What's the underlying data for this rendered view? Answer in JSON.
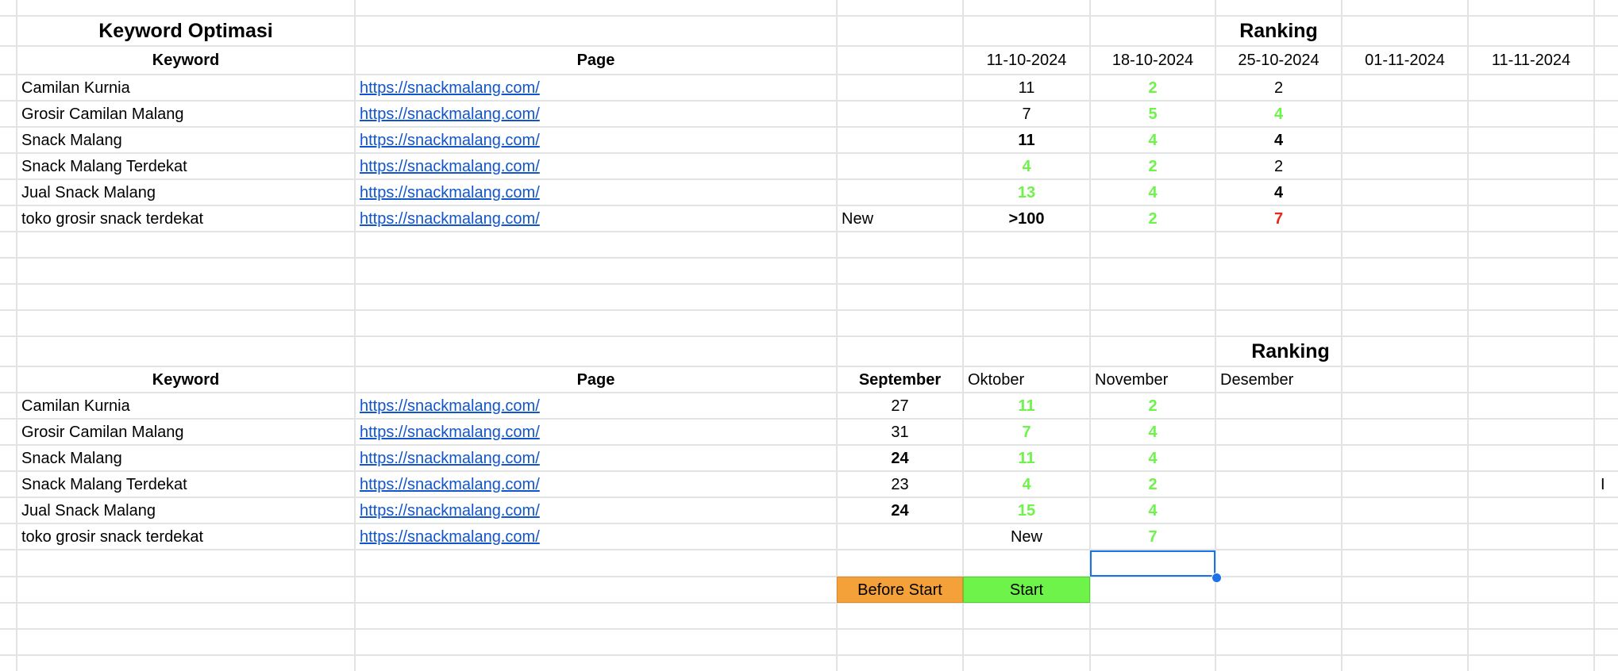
{
  "colors": {
    "link": "#1155cc",
    "ranking_improved": "#6ef34a",
    "ranking_dropped": "#e8271d",
    "before_start_fill": "#f4a13a",
    "start_fill": "#6ef34a",
    "gridline": "#e2e3e3",
    "selection": "#1a73e8"
  },
  "weekly": {
    "title": "Keyword Optimasi",
    "ranking_title": "Ranking",
    "headers": {
      "keyword": "Keyword",
      "page": "Page"
    },
    "dates": [
      "11-10-2024",
      "18-10-2024",
      "25-10-2024",
      "01-11-2024",
      "11-11-2024"
    ],
    "rows": [
      {
        "keyword": "Camilan Kurnia",
        "page": "https://snackmalang.com/",
        "note": "",
        "ranks": [
          {
            "v": "11",
            "s": "normal"
          },
          {
            "v": "2",
            "s": "green"
          },
          {
            "v": "2",
            "s": "normal"
          }
        ]
      },
      {
        "keyword": "Grosir Camilan Malang",
        "page": "https://snackmalang.com/",
        "note": "",
        "ranks": [
          {
            "v": "7",
            "s": "normal"
          },
          {
            "v": "5",
            "s": "green"
          },
          {
            "v": "4",
            "s": "green"
          }
        ]
      },
      {
        "keyword": "Snack Malang",
        "page": "https://snackmalang.com/",
        "note": "",
        "ranks": [
          {
            "v": "11",
            "s": "bold"
          },
          {
            "v": "4",
            "s": "green"
          },
          {
            "v": "4",
            "s": "bold"
          }
        ]
      },
      {
        "keyword": "Snack Malang Terdekat",
        "page": "https://snackmalang.com/",
        "note": "",
        "ranks": [
          {
            "v": "4",
            "s": "green"
          },
          {
            "v": "2",
            "s": "green"
          },
          {
            "v": "2",
            "s": "normal"
          }
        ]
      },
      {
        "keyword": "Jual Snack Malang",
        "page": "https://snackmalang.com/",
        "note": "",
        "ranks": [
          {
            "v": "13",
            "s": "green"
          },
          {
            "v": "4",
            "s": "green"
          },
          {
            "v": "4",
            "s": "bold"
          }
        ]
      },
      {
        "keyword": "toko grosir snack terdekat",
        "page": "https://snackmalang.com/",
        "note": "New",
        "ranks": [
          {
            "v": ">100",
            "s": "bold"
          },
          {
            "v": "2",
            "s": "green"
          },
          {
            "v": "7",
            "s": "red"
          }
        ]
      }
    ]
  },
  "monthly": {
    "ranking_title": "Ranking",
    "headers": {
      "keyword": "Keyword",
      "page": "Page"
    },
    "months": [
      "September",
      "Oktober",
      "November",
      "Desember"
    ],
    "rows": [
      {
        "keyword": "Camilan Kurnia",
        "page": "https://snackmalang.com/",
        "ranks": [
          {
            "v": "27",
            "s": "normal"
          },
          {
            "v": "11",
            "s": "green"
          },
          {
            "v": "2",
            "s": "green"
          }
        ]
      },
      {
        "keyword": "Grosir Camilan Malang",
        "page": "https://snackmalang.com/",
        "ranks": [
          {
            "v": "31",
            "s": "normal"
          },
          {
            "v": "7",
            "s": "green"
          },
          {
            "v": "4",
            "s": "green"
          }
        ]
      },
      {
        "keyword": "Snack Malang",
        "page": "https://snackmalang.com/",
        "ranks": [
          {
            "v": "24",
            "s": "bold"
          },
          {
            "v": "11",
            "s": "green"
          },
          {
            "v": "4",
            "s": "green"
          }
        ]
      },
      {
        "keyword": "Snack Malang Terdekat",
        "page": "https://snackmalang.com/",
        "ranks": [
          {
            "v": "23",
            "s": "normal"
          },
          {
            "v": "4",
            "s": "green"
          },
          {
            "v": "2",
            "s": "green"
          }
        ]
      },
      {
        "keyword": "Jual Snack Malang",
        "page": "https://snackmalang.com/",
        "ranks": [
          {
            "v": "24",
            "s": "bold"
          },
          {
            "v": "15",
            "s": "green"
          },
          {
            "v": "4",
            "s": "green"
          }
        ]
      },
      {
        "keyword": "toko grosir snack terdekat",
        "page": "https://snackmalang.com/",
        "ranks": [
          {
            "v": "",
            "s": "normal"
          },
          {
            "v": "New",
            "s": "normal"
          },
          {
            "v": "7",
            "s": "green"
          }
        ]
      }
    ],
    "legend": {
      "before_start": "Before Start",
      "start": "Start"
    },
    "stray_char": "I"
  }
}
